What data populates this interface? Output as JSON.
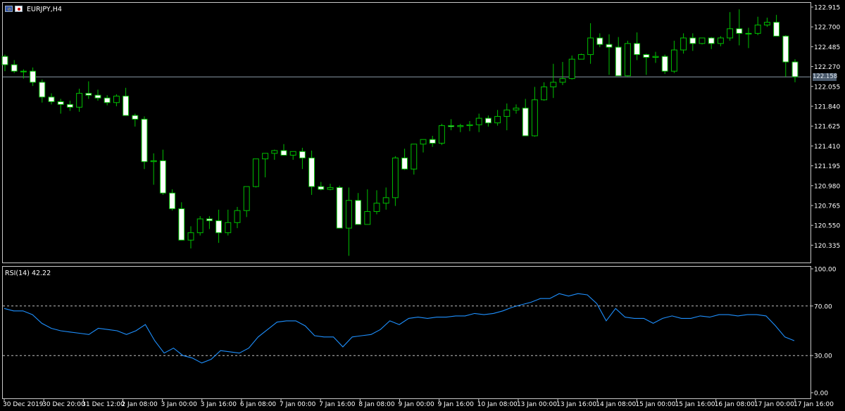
{
  "header": {
    "symbol_label": "EURJPY,H4",
    "icons": [
      "eu-flag-icon",
      "japan-flag-icon"
    ]
  },
  "price_axis": {
    "ticks": [
      "122.915",
      "122.700",
      "122.485",
      "122.270",
      "122.055",
      "121.840",
      "121.625",
      "121.410",
      "121.195",
      "120.980",
      "120.765",
      "120.550",
      "120.335"
    ],
    "current_price_label": "122.158"
  },
  "time_axis": {
    "labels": [
      "30 Dec 2019",
      "30 Dec 20:00",
      "31 Dec 12:00",
      "2 Jan 08:00",
      "3 Jan 00:00",
      "3 Jan 16:00",
      "6 Jan 08:00",
      "7 Jan 00:00",
      "7 Jan 16:00",
      "8 Jan 08:00",
      "9 Jan 00:00",
      "9 Jan 16:00",
      "10 Jan 08:00",
      "13 Jan 00:00",
      "13 Jan 16:00",
      "14 Jan 08:00",
      "15 Jan 00:00",
      "15 Jan 16:00",
      "16 Jan 08:00",
      "17 Jan 00:00",
      "17 Jan 16:00"
    ]
  },
  "rsi_panel": {
    "label": "RSI(14) 42.22",
    "ticks": [
      "100.00",
      "70.00",
      "30.00",
      "0.00"
    ],
    "levels": [
      70,
      30
    ]
  },
  "colors": {
    "background": "#000000",
    "bull_wick": "#00c000",
    "bull_body": "#000000",
    "bear_body": "#ffffff",
    "rsi_line": "#1e90ff",
    "grid": "#c0c0c0"
  },
  "chart_data": [
    {
      "type": "candlestick",
      "title": "EURJPY,H4",
      "ylim": [
        120.25,
        122.95
      ],
      "current_price": 122.158,
      "ohlc": [
        [
          122.38,
          122.4,
          122.22,
          122.29
        ],
        [
          122.29,
          122.34,
          122.2,
          122.22
        ],
        [
          122.22,
          122.24,
          122.14,
          122.22
        ],
        [
          122.22,
          122.26,
          122.06,
          122.1
        ],
        [
          122.1,
          122.13,
          121.88,
          121.94
        ],
        [
          121.94,
          121.98,
          121.86,
          121.89
        ],
        [
          121.89,
          121.92,
          121.76,
          121.86
        ],
        [
          121.86,
          121.9,
          121.79,
          121.83
        ],
        [
          121.83,
          122.03,
          121.78,
          121.98
        ],
        [
          121.98,
          122.11,
          121.92,
          121.96
        ],
        [
          121.96,
          122.02,
          121.9,
          121.93
        ],
        [
          121.93,
          121.96,
          121.85,
          121.88
        ],
        [
          121.88,
          121.97,
          121.84,
          121.95
        ],
        [
          121.95,
          122.04,
          121.76,
          121.74
        ],
        [
          121.74,
          121.76,
          121.62,
          121.7
        ],
        [
          121.7,
          121.73,
          121.16,
          121.24
        ],
        [
          121.24,
          121.33,
          120.99,
          121.25
        ],
        [
          121.25,
          121.37,
          120.88,
          120.9
        ],
        [
          120.9,
          120.94,
          120.71,
          120.73
        ],
        [
          120.73,
          120.8,
          120.4,
          120.39
        ],
        [
          120.39,
          120.54,
          120.3,
          120.47
        ],
        [
          120.47,
          120.65,
          120.44,
          120.62
        ],
        [
          120.62,
          120.65,
          120.51,
          120.6
        ],
        [
          120.6,
          120.72,
          120.36,
          120.47
        ],
        [
          120.47,
          120.72,
          120.44,
          120.58
        ],
        [
          120.58,
          120.75,
          120.52,
          120.71
        ],
        [
          120.71,
          120.89,
          120.64,
          120.97
        ],
        [
          120.97,
          121.19,
          120.96,
          121.27
        ],
        [
          121.27,
          121.3,
          121.07,
          121.33
        ],
        [
          121.33,
          121.37,
          121.26,
          121.36
        ],
        [
          121.36,
          121.43,
          121.31,
          121.31
        ],
        [
          121.31,
          121.35,
          121.26,
          121.35
        ],
        [
          121.35,
          121.39,
          121.16,
          121.28
        ],
        [
          121.28,
          121.36,
          120.88,
          120.97
        ],
        [
          120.97,
          121.02,
          120.93,
          120.94
        ],
        [
          120.94,
          121.0,
          120.93,
          120.96
        ],
        [
          120.96,
          120.98,
          120.84,
          120.52
        ],
        [
          120.52,
          120.96,
          120.22,
          120.82
        ],
        [
          120.82,
          120.9,
          120.71,
          120.56
        ],
        [
          120.56,
          120.94,
          120.56,
          120.7
        ],
        [
          120.7,
          120.93,
          120.67,
          120.79
        ],
        [
          120.79,
          120.96,
          120.72,
          120.85
        ],
        [
          120.85,
          121.3,
          120.76,
          121.28
        ],
        [
          121.28,
          121.38,
          121.15,
          121.16
        ],
        [
          121.16,
          121.34,
          121.1,
          121.43
        ],
        [
          121.43,
          121.48,
          121.34,
          121.48
        ],
        [
          121.48,
          121.52,
          121.4,
          121.44
        ],
        [
          121.44,
          121.65,
          121.42,
          121.63
        ],
        [
          121.63,
          121.7,
          121.58,
          121.62
        ],
        [
          121.62,
          121.65,
          121.56,
          121.63
        ],
        [
          121.63,
          121.68,
          121.57,
          121.64
        ],
        [
          121.64,
          121.76,
          121.56,
          121.71
        ],
        [
          121.71,
          121.74,
          121.62,
          121.66
        ],
        [
          121.66,
          121.8,
          121.63,
          121.73
        ],
        [
          121.73,
          121.87,
          121.58,
          121.8
        ],
        [
          121.8,
          121.86,
          121.76,
          121.82
        ],
        [
          121.82,
          121.92,
          121.6,
          121.52
        ],
        [
          121.52,
          122.05,
          121.51,
          121.91
        ],
        [
          121.91,
          122.1,
          121.9,
          122.05
        ],
        [
          122.05,
          122.3,
          121.93,
          122.1
        ],
        [
          122.1,
          122.32,
          122.07,
          122.14
        ],
        [
          122.14,
          122.39,
          122.13,
          122.35
        ],
        [
          122.35,
          122.41,
          122.38,
          122.4
        ],
        [
          122.4,
          122.74,
          122.3,
          122.58
        ],
        [
          122.58,
          122.63,
          122.48,
          122.51
        ],
        [
          122.51,
          122.62,
          122.18,
          122.48
        ],
        [
          122.48,
          122.59,
          122.19,
          122.17
        ],
        [
          122.17,
          122.55,
          122.16,
          122.52
        ],
        [
          122.52,
          122.64,
          122.34,
          122.4
        ],
        [
          122.4,
          122.41,
          122.18,
          122.37
        ],
        [
          122.37,
          122.43,
          122.31,
          122.38
        ],
        [
          122.38,
          122.4,
          122.19,
          122.22
        ],
        [
          122.22,
          122.55,
          122.2,
          122.45
        ],
        [
          122.45,
          122.63,
          122.41,
          122.58
        ],
        [
          122.58,
          122.63,
          122.44,
          122.52
        ],
        [
          122.52,
          122.58,
          122.51,
          122.58
        ],
        [
          122.58,
          122.59,
          122.46,
          122.52
        ],
        [
          122.52,
          122.6,
          122.49,
          122.58
        ],
        [
          122.58,
          122.86,
          122.55,
          122.68
        ],
        [
          122.68,
          122.89,
          122.5,
          122.63
        ],
        [
          122.63,
          122.69,
          122.47,
          122.63
        ],
        [
          122.63,
          122.81,
          122.61,
          122.72
        ],
        [
          122.72,
          122.8,
          122.7,
          122.75
        ],
        [
          122.75,
          122.83,
          122.69,
          122.6
        ],
        [
          122.6,
          122.61,
          122.16,
          122.32
        ],
        [
          122.32,
          122.35,
          122.1,
          122.16
        ]
      ]
    },
    {
      "type": "line",
      "title": "RSI(14) 42.22",
      "ylim": [
        0,
        100
      ],
      "levels": [
        70,
        30
      ],
      "series": [
        {
          "values": [
            68,
            66,
            66,
            63,
            56,
            52,
            50,
            49,
            48,
            47,
            52,
            51,
            50,
            47,
            50,
            55,
            42,
            32,
            36,
            30,
            28,
            24,
            27,
            34,
            33,
            32,
            36,
            45,
            51,
            57,
            58,
            58,
            54,
            46,
            45,
            45,
            37,
            45,
            46,
            47,
            51,
            58,
            55,
            60,
            61,
            60,
            61,
            61,
            62,
            62,
            64,
            63,
            64,
            66,
            69,
            71,
            73,
            76,
            76,
            80,
            78,
            80,
            79,
            72,
            58,
            68,
            61,
            60,
            60,
            56,
            60,
            62,
            60,
            60,
            62,
            61,
            63,
            63,
            62,
            63,
            63,
            62,
            54,
            45,
            42
          ]
        }
      ]
    }
  ]
}
